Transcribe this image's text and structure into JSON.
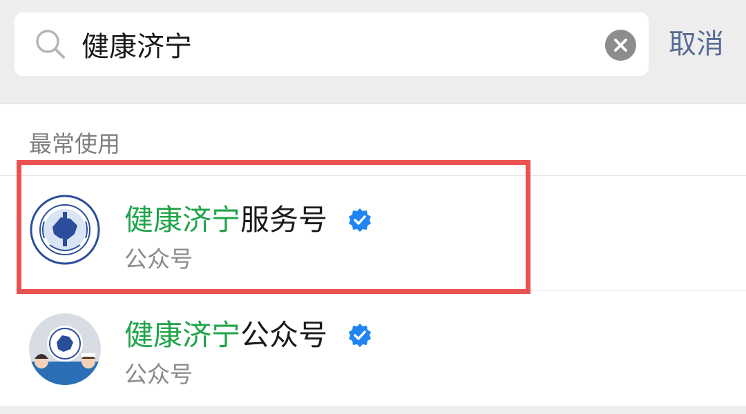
{
  "search": {
    "value": "健康济宁",
    "cancel_label": "取消"
  },
  "results": {
    "section_title": "最常使用",
    "items": [
      {
        "highlight": "健康济宁",
        "suffix": "服务号",
        "subtitle": "公众号",
        "verified": true
      },
      {
        "highlight": "健康济宁",
        "suffix": "公众号",
        "subtitle": "公众号",
        "verified": true
      }
    ]
  },
  "colors": {
    "highlight_text": "#21a44a",
    "cancel_text": "#576b95",
    "verified_badge": "#1e85f2",
    "annotation_box": "#e9524f"
  }
}
